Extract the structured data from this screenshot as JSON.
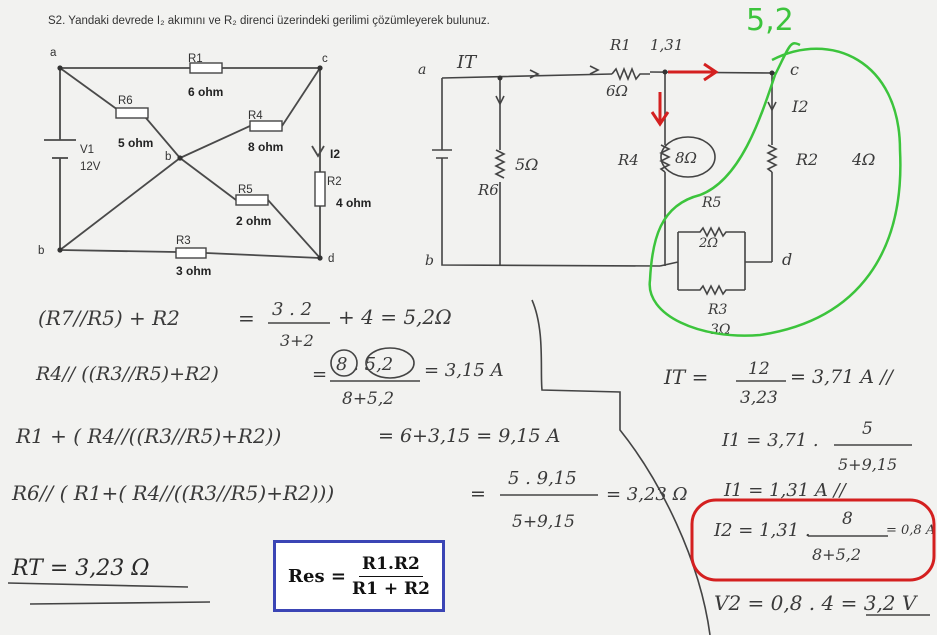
{
  "problem": {
    "statement": "S2. Yandaki devrede I₂ akımını ve R₂ direnci üzerindeki gerilimi çözümleyerek bulunuz."
  },
  "printed_circuit": {
    "nodes": {
      "a": "a",
      "b": "b",
      "c": "c",
      "d": "d",
      "center": "b"
    },
    "r1": {
      "name": "R1",
      "value": "6 ohm"
    },
    "r6": {
      "name": "R6",
      "value": "5 ohm"
    },
    "r4": {
      "name": "R4",
      "value": "8 ohm"
    },
    "r5": {
      "name": "R5",
      "value": "2 ohm"
    },
    "r3": {
      "name": "R3",
      "value": "3 ohm"
    },
    "r2": {
      "name": "R2",
      "value": "4 ohm"
    },
    "v1": {
      "name": "V1",
      "value": "12V"
    },
    "current": "I2"
  },
  "hand_circuit": {
    "node_a": "a",
    "node_b": "b",
    "node_c": "c",
    "node_d": "d",
    "it": "IT",
    "r1_label": "R1",
    "r1_current": "1,31",
    "r1_value": "6Ω",
    "r6_label": "R6",
    "r6_value": "5Ω",
    "r4_label": "R4",
    "r4_value": "8Ω",
    "r2_label": "R2",
    "r2_value": "4Ω",
    "i2_label": "I2",
    "r5_label": "R5",
    "r5_value": "2Ω",
    "r3_label": "R3",
    "r3_value": "3Ω",
    "equiv_note": "5,2"
  },
  "calculations": {
    "line1_lhs": "(R7//R5) + R2",
    "line1_eq": "=",
    "line1_num": "3 . 2",
    "line1_den": "3+2",
    "line1_rest": "+ 4 = 5,2Ω",
    "line2_lhs": "R4// ((R3//R5)+R2)",
    "line2_num": "8 . 5,2",
    "line2_den": "8+5,2",
    "line2_rest": "= 3,15 A",
    "line3_lhs": "R1 + ( R4//((R3//R5)+R2))",
    "line3_rest": "= 6+3,15 = 9,15 A",
    "line4_lhs": "R6// ( R1+( R4//((R3//R5)+R2)))",
    "line4_num": "5 . 9,15",
    "line4_den": "5+9,15",
    "line4_rest": "= 3,23 Ω",
    "total": "RT = 3,23 Ω"
  },
  "current_calcs": {
    "it_lhs": "IT =",
    "it_num": "12",
    "it_den": "3,23",
    "it_rest": "= 3,71 A //",
    "i1_lhs": "I1 = 3,71 .",
    "i1_num": "5",
    "i1_den": "5+9,15",
    "i1_result": "I1 = 1,31 A //",
    "i2_lhs": "I2 = 1,31 .",
    "i2_num": "8",
    "i2_den": "8+5,2",
    "i2_result": "= 0,8 A",
    "v2": "V2 = 0,8 . 4 = 3,2 V"
  },
  "formula_box": {
    "lhs": "Res =",
    "numerator": "R1.R2",
    "denominator": "R1 + R2"
  },
  "colors": {
    "ink": "#3a3a3a",
    "green_marker": "#3cc43c",
    "red_marker": "#d42020",
    "formula_border": "#3b45b5",
    "background": "#f2f2f0"
  }
}
